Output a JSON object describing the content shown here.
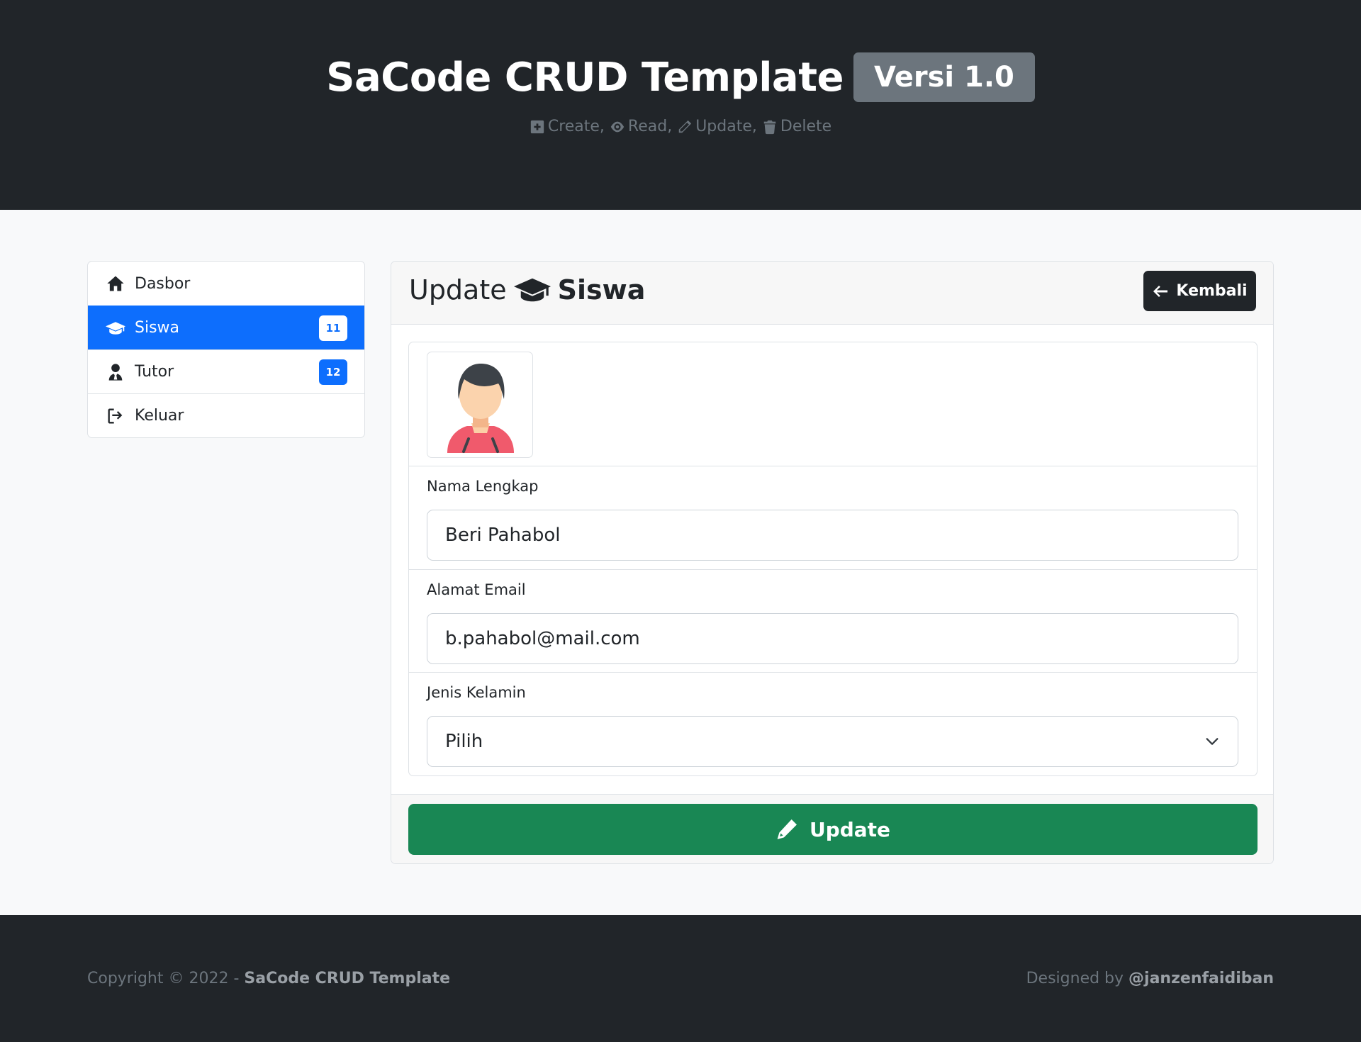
{
  "header": {
    "title": "SaCode CRUD Template",
    "version": "Versi 1.0",
    "features": [
      {
        "icon": "plus-square-icon",
        "label": "Create,"
      },
      {
        "icon": "eye-icon",
        "label": "Read,"
      },
      {
        "icon": "pencil-icon",
        "label": "Update,"
      },
      {
        "icon": "trash-icon",
        "label": "Delete"
      }
    ]
  },
  "sidebar": {
    "items": [
      {
        "icon": "home-icon",
        "label": "Dasbor",
        "badge": null,
        "active": false
      },
      {
        "icon": "graduation-cap-icon",
        "label": "Siswa",
        "badge": "11",
        "active": true
      },
      {
        "icon": "user-tie-icon",
        "label": "Tutor",
        "badge": "12",
        "active": false
      },
      {
        "icon": "sign-out-icon",
        "label": "Keluar",
        "badge": null,
        "active": false
      }
    ]
  },
  "card": {
    "title_prefix": "Update",
    "title_icon": "graduation-cap-icon",
    "title_entity": "Siswa",
    "back_label": "Kembali",
    "fields": {
      "name": {
        "label": "Nama Lengkap",
        "value": "Beri Pahabol"
      },
      "email": {
        "label": "Alamat Email",
        "value": "b.pahabol@mail.com"
      },
      "gender": {
        "label": "Jenis Kelamin",
        "value": "Pilih"
      }
    },
    "submit_label": "Update"
  },
  "footer": {
    "copyright_prefix": "Copyright © 2022 -",
    "copyright_brand": "SaCode CRUD Template",
    "designed_prefix": "Designed by",
    "designed_author": "@janzenfaidiban"
  },
  "colors": {
    "dark": "#212529",
    "primary": "#0d6efd",
    "success": "#198754",
    "secondary": "#6c757d"
  }
}
